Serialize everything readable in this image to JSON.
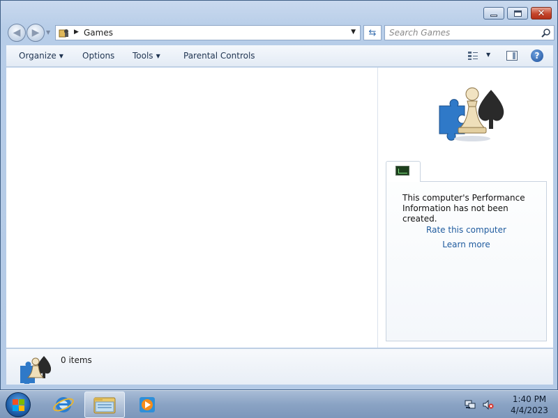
{
  "window": {
    "controls": {
      "minimize": "minimize",
      "maximize": "maximize",
      "close": "✕"
    }
  },
  "navigation": {
    "address": "Games",
    "search_placeholder": "Search Games"
  },
  "toolbar": {
    "organize_label": "Organize",
    "options_label": "Options",
    "tools_label": "Tools",
    "parental_controls_label": "Parental Controls"
  },
  "preview_pane": {
    "performance_message": "This computer's Performance Information has not been created.",
    "rate_link": "Rate this computer",
    "learn_more_link": "Learn more"
  },
  "details_pane": {
    "item_count": "0 items"
  },
  "taskbar": {
    "pinned": [
      "internet-explorer",
      "windows-explorer",
      "windows-media-player"
    ],
    "clock_time": "1:40 PM",
    "clock_date": "4/4/2023"
  },
  "colors": {
    "link": "#1f5b9e",
    "taskbar": "#8aa3c4",
    "close_button": "#c5452b"
  }
}
